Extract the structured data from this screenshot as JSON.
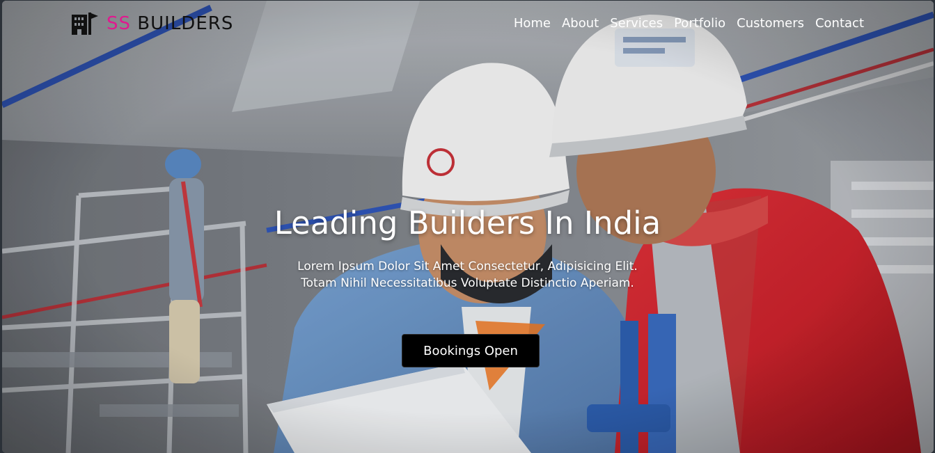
{
  "brand": {
    "icon": "building-flag-icon",
    "accent": "SS",
    "name": "BUILDERS",
    "accent_color": "#e0198f",
    "name_color": "#111111"
  },
  "nav": {
    "items": [
      {
        "label": "Home"
      },
      {
        "label": "About"
      },
      {
        "label": "Services"
      },
      {
        "label": "Portfolio"
      },
      {
        "label": "Customers"
      },
      {
        "label": "Contact"
      }
    ]
  },
  "hero": {
    "title": "Leading Builders In India",
    "subtitle_line1": "Lorem Ipsum Dolor Sit Amet Consectetur, Adipisicing Elit.",
    "subtitle_line2": "Totam Nihil Necessitatibus Voluptate Distinctio Aperiam.",
    "cta_label": "Bookings Open",
    "image": "construction-workers-photo",
    "colors": {
      "text": "#ffffff",
      "cta_background": "#000000",
      "helmet": "#f4f4f4",
      "shirt_red": "#d8232b",
      "shirt_blue": "#6c98cc",
      "pipe_blue": "#2f55b8"
    }
  }
}
